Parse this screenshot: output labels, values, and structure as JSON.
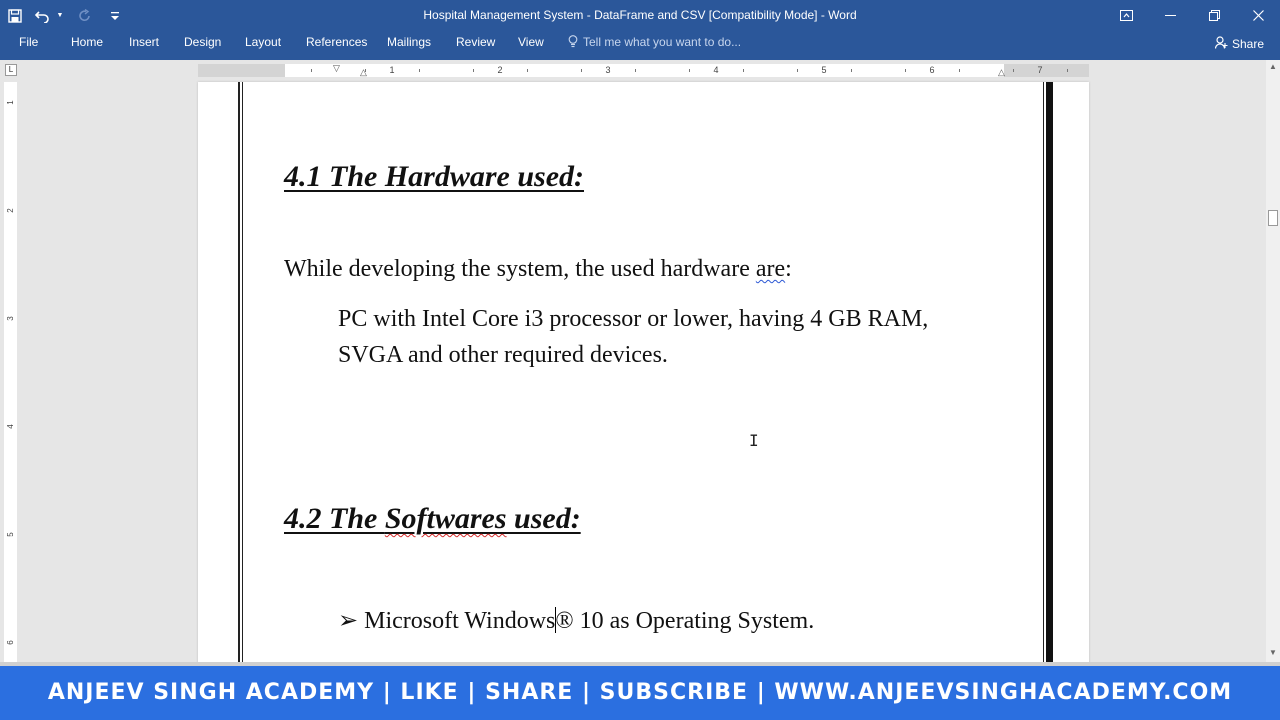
{
  "window": {
    "title": "Hospital Management System - DataFrame and CSV [Compatibility Mode] - Word"
  },
  "qat": {
    "save_icon": "save-icon",
    "undo_icon": "undo-icon",
    "redo_icon": "redo-icon",
    "customize_icon": "customize-qat-icon"
  },
  "window_controls": [
    "ribbon-display-options-icon",
    "minimize-icon",
    "restore-icon",
    "close-icon"
  ],
  "ribbon": {
    "tabs": [
      "File",
      "Home",
      "Insert",
      "Design",
      "Layout",
      "References",
      "Mailings",
      "Review",
      "View"
    ],
    "tell_me_placeholder": "Tell me what you want to do...",
    "share_label": "Share"
  },
  "ruler": {
    "marks": [
      "1",
      "2",
      "3",
      "4",
      "5",
      "6",
      "7"
    ],
    "vertical_marks": [
      "1",
      "2",
      "3",
      "4",
      "5",
      "6"
    ]
  },
  "document": {
    "heading1": "4.1 The Hardware used:",
    "para1_before": "While developing the system, the used hardware ",
    "para1_flagged": "are",
    "para1_after": ":",
    "para2_line1": "PC with Intel Core i3 processor or lower, having 4 GB RAM,",
    "para2_line2": "SVGA and other required devices.",
    "heading2_before": "4.2 The ",
    "heading2_flagged": "Softwares",
    "heading2_after": " used:",
    "bullet_glyph": "➢",
    "bullet1_before_caret": " Microsoft Windows",
    "bullet1_after_caret": "® 10 as Operating System."
  },
  "banner": {
    "text": "ANJEEV SINGH ACADEMY | LIKE | SHARE | SUBSCRIBE | WWW.ANJEEVSINGHACADEMY.COM"
  },
  "colors": {
    "word_blue": "#2b579a",
    "banner_blue": "#2b6fe0",
    "grammar_squiggle": "#2b57d4",
    "spelling_squiggle": "#d42b2b"
  }
}
